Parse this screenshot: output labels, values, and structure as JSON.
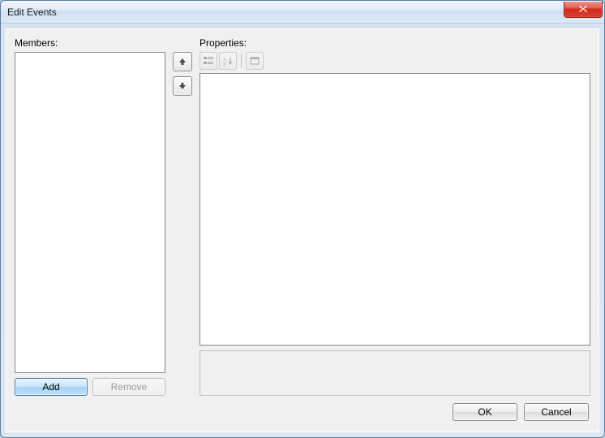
{
  "title": "Edit Events",
  "labels": {
    "members": "Members:",
    "properties": "Properties:"
  },
  "buttons": {
    "add": "Add",
    "remove": "Remove",
    "ok": "OK",
    "cancel": "Cancel"
  },
  "icons": {
    "close": "close-icon",
    "up": "arrow-up-icon",
    "down": "arrow-down-icon",
    "categorized": "categorized-icon",
    "alphabetical": "alphabetical-icon",
    "property_pages": "property-pages-icon"
  }
}
